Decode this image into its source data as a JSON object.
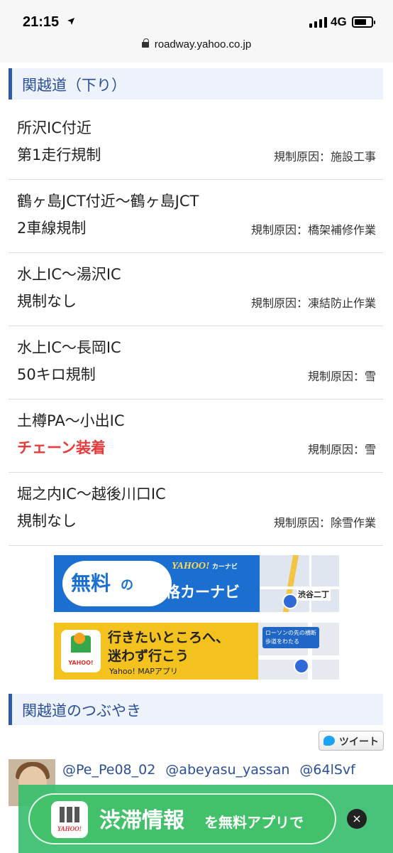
{
  "status_bar": {
    "time": "21:15",
    "network": "4G",
    "url": "roadway.yahoo.co.jp"
  },
  "section": {
    "title": "関越道（下り）"
  },
  "regulations": [
    {
      "location": "所沢IC付近",
      "status": "第1走行規制",
      "cause": "規制原因：施設工事",
      "highlight": false
    },
    {
      "location": "鶴ヶ島JCT付近〜鶴ヶ島JCT",
      "status": "2車線規制",
      "cause": "規制原因：橋架補修作業",
      "highlight": false
    },
    {
      "location": "水上IC〜湯沢IC",
      "status": "規制なし",
      "cause": "規制原因：凍結防止作業",
      "highlight": false
    },
    {
      "location": "水上IC〜長岡IC",
      "status": "50キロ規制",
      "cause": "規制原因：雪",
      "highlight": false
    },
    {
      "location": "土樽PA〜小出IC",
      "status": "チェーン装着",
      "cause": "規制原因：雪",
      "highlight": true
    },
    {
      "location": "堀之内IC〜越後川口IC",
      "status": "規制なし",
      "cause": "規制原因：除雪作業",
      "highlight": false
    }
  ],
  "banner_carnavi": {
    "free": "無料",
    "no": "の",
    "brand": "YAHOO!",
    "brand_sub": "カーナビ",
    "main": "本格カーナビ",
    "sign": "渋谷二丁"
  },
  "banner_map": {
    "line1": "行きたいところへ、",
    "line2": "迷わず行こう",
    "sub": "Yahoo! MAPアプリ",
    "tip": "ローソンの先の横断歩道をわたる",
    "app_label": "YAHOO!"
  },
  "tweets_section": {
    "title": "関越道のつぶやき",
    "tweet_button": "ツイート",
    "handles": [
      "@Pe_Pe08_02",
      "@abeyasu_yassan",
      "@64lSvf"
    ]
  },
  "promo": {
    "app_label": "YAHOO!",
    "big": "渋滞情報",
    "small": "を無料アプリで",
    "close": "×"
  },
  "colors": {
    "accent_blue": "#2a4f96",
    "alert_red": "#e63b3b",
    "promo_green": "#42c06a"
  }
}
